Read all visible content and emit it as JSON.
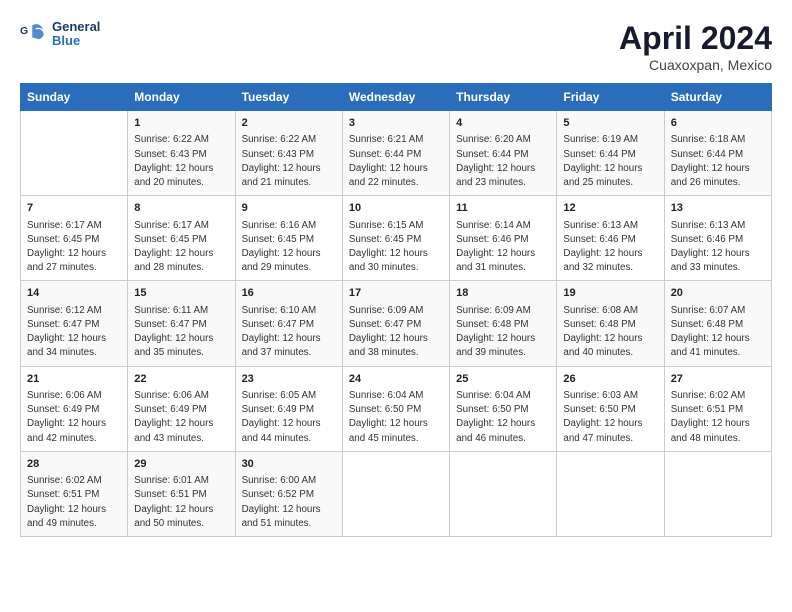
{
  "header": {
    "logo_line1": "General",
    "logo_line2": "Blue",
    "title": "April 2024",
    "subtitle": "Cuaxoxpan, Mexico"
  },
  "weekdays": [
    "Sunday",
    "Monday",
    "Tuesday",
    "Wednesday",
    "Thursday",
    "Friday",
    "Saturday"
  ],
  "weeks": [
    [
      {
        "num": "",
        "lines": []
      },
      {
        "num": "1",
        "lines": [
          "Sunrise: 6:22 AM",
          "Sunset: 6:43 PM",
          "Daylight: 12 hours",
          "and 20 minutes."
        ]
      },
      {
        "num": "2",
        "lines": [
          "Sunrise: 6:22 AM",
          "Sunset: 6:43 PM",
          "Daylight: 12 hours",
          "and 21 minutes."
        ]
      },
      {
        "num": "3",
        "lines": [
          "Sunrise: 6:21 AM",
          "Sunset: 6:44 PM",
          "Daylight: 12 hours",
          "and 22 minutes."
        ]
      },
      {
        "num": "4",
        "lines": [
          "Sunrise: 6:20 AM",
          "Sunset: 6:44 PM",
          "Daylight: 12 hours",
          "and 23 minutes."
        ]
      },
      {
        "num": "5",
        "lines": [
          "Sunrise: 6:19 AM",
          "Sunset: 6:44 PM",
          "Daylight: 12 hours",
          "and 25 minutes."
        ]
      },
      {
        "num": "6",
        "lines": [
          "Sunrise: 6:18 AM",
          "Sunset: 6:44 PM",
          "Daylight: 12 hours",
          "and 26 minutes."
        ]
      }
    ],
    [
      {
        "num": "7",
        "lines": [
          "Sunrise: 6:17 AM",
          "Sunset: 6:45 PM",
          "Daylight: 12 hours",
          "and 27 minutes."
        ]
      },
      {
        "num": "8",
        "lines": [
          "Sunrise: 6:17 AM",
          "Sunset: 6:45 PM",
          "Daylight: 12 hours",
          "and 28 minutes."
        ]
      },
      {
        "num": "9",
        "lines": [
          "Sunrise: 6:16 AM",
          "Sunset: 6:45 PM",
          "Daylight: 12 hours",
          "and 29 minutes."
        ]
      },
      {
        "num": "10",
        "lines": [
          "Sunrise: 6:15 AM",
          "Sunset: 6:45 PM",
          "Daylight: 12 hours",
          "and 30 minutes."
        ]
      },
      {
        "num": "11",
        "lines": [
          "Sunrise: 6:14 AM",
          "Sunset: 6:46 PM",
          "Daylight: 12 hours",
          "and 31 minutes."
        ]
      },
      {
        "num": "12",
        "lines": [
          "Sunrise: 6:13 AM",
          "Sunset: 6:46 PM",
          "Daylight: 12 hours",
          "and 32 minutes."
        ]
      },
      {
        "num": "13",
        "lines": [
          "Sunrise: 6:13 AM",
          "Sunset: 6:46 PM",
          "Daylight: 12 hours",
          "and 33 minutes."
        ]
      }
    ],
    [
      {
        "num": "14",
        "lines": [
          "Sunrise: 6:12 AM",
          "Sunset: 6:47 PM",
          "Daylight: 12 hours",
          "and 34 minutes."
        ]
      },
      {
        "num": "15",
        "lines": [
          "Sunrise: 6:11 AM",
          "Sunset: 6:47 PM",
          "Daylight: 12 hours",
          "and 35 minutes."
        ]
      },
      {
        "num": "16",
        "lines": [
          "Sunrise: 6:10 AM",
          "Sunset: 6:47 PM",
          "Daylight: 12 hours",
          "and 37 minutes."
        ]
      },
      {
        "num": "17",
        "lines": [
          "Sunrise: 6:09 AM",
          "Sunset: 6:47 PM",
          "Daylight: 12 hours",
          "and 38 minutes."
        ]
      },
      {
        "num": "18",
        "lines": [
          "Sunrise: 6:09 AM",
          "Sunset: 6:48 PM",
          "Daylight: 12 hours",
          "and 39 minutes."
        ]
      },
      {
        "num": "19",
        "lines": [
          "Sunrise: 6:08 AM",
          "Sunset: 6:48 PM",
          "Daylight: 12 hours",
          "and 40 minutes."
        ]
      },
      {
        "num": "20",
        "lines": [
          "Sunrise: 6:07 AM",
          "Sunset: 6:48 PM",
          "Daylight: 12 hours",
          "and 41 minutes."
        ]
      }
    ],
    [
      {
        "num": "21",
        "lines": [
          "Sunrise: 6:06 AM",
          "Sunset: 6:49 PM",
          "Daylight: 12 hours",
          "and 42 minutes."
        ]
      },
      {
        "num": "22",
        "lines": [
          "Sunrise: 6:06 AM",
          "Sunset: 6:49 PM",
          "Daylight: 12 hours",
          "and 43 minutes."
        ]
      },
      {
        "num": "23",
        "lines": [
          "Sunrise: 6:05 AM",
          "Sunset: 6:49 PM",
          "Daylight: 12 hours",
          "and 44 minutes."
        ]
      },
      {
        "num": "24",
        "lines": [
          "Sunrise: 6:04 AM",
          "Sunset: 6:50 PM",
          "Daylight: 12 hours",
          "and 45 minutes."
        ]
      },
      {
        "num": "25",
        "lines": [
          "Sunrise: 6:04 AM",
          "Sunset: 6:50 PM",
          "Daylight: 12 hours",
          "and 46 minutes."
        ]
      },
      {
        "num": "26",
        "lines": [
          "Sunrise: 6:03 AM",
          "Sunset: 6:50 PM",
          "Daylight: 12 hours",
          "and 47 minutes."
        ]
      },
      {
        "num": "27",
        "lines": [
          "Sunrise: 6:02 AM",
          "Sunset: 6:51 PM",
          "Daylight: 12 hours",
          "and 48 minutes."
        ]
      }
    ],
    [
      {
        "num": "28",
        "lines": [
          "Sunrise: 6:02 AM",
          "Sunset: 6:51 PM",
          "Daylight: 12 hours",
          "and 49 minutes."
        ]
      },
      {
        "num": "29",
        "lines": [
          "Sunrise: 6:01 AM",
          "Sunset: 6:51 PM",
          "Daylight: 12 hours",
          "and 50 minutes."
        ]
      },
      {
        "num": "30",
        "lines": [
          "Sunrise: 6:00 AM",
          "Sunset: 6:52 PM",
          "Daylight: 12 hours",
          "and 51 minutes."
        ]
      },
      {
        "num": "",
        "lines": []
      },
      {
        "num": "",
        "lines": []
      },
      {
        "num": "",
        "lines": []
      },
      {
        "num": "",
        "lines": []
      }
    ]
  ]
}
